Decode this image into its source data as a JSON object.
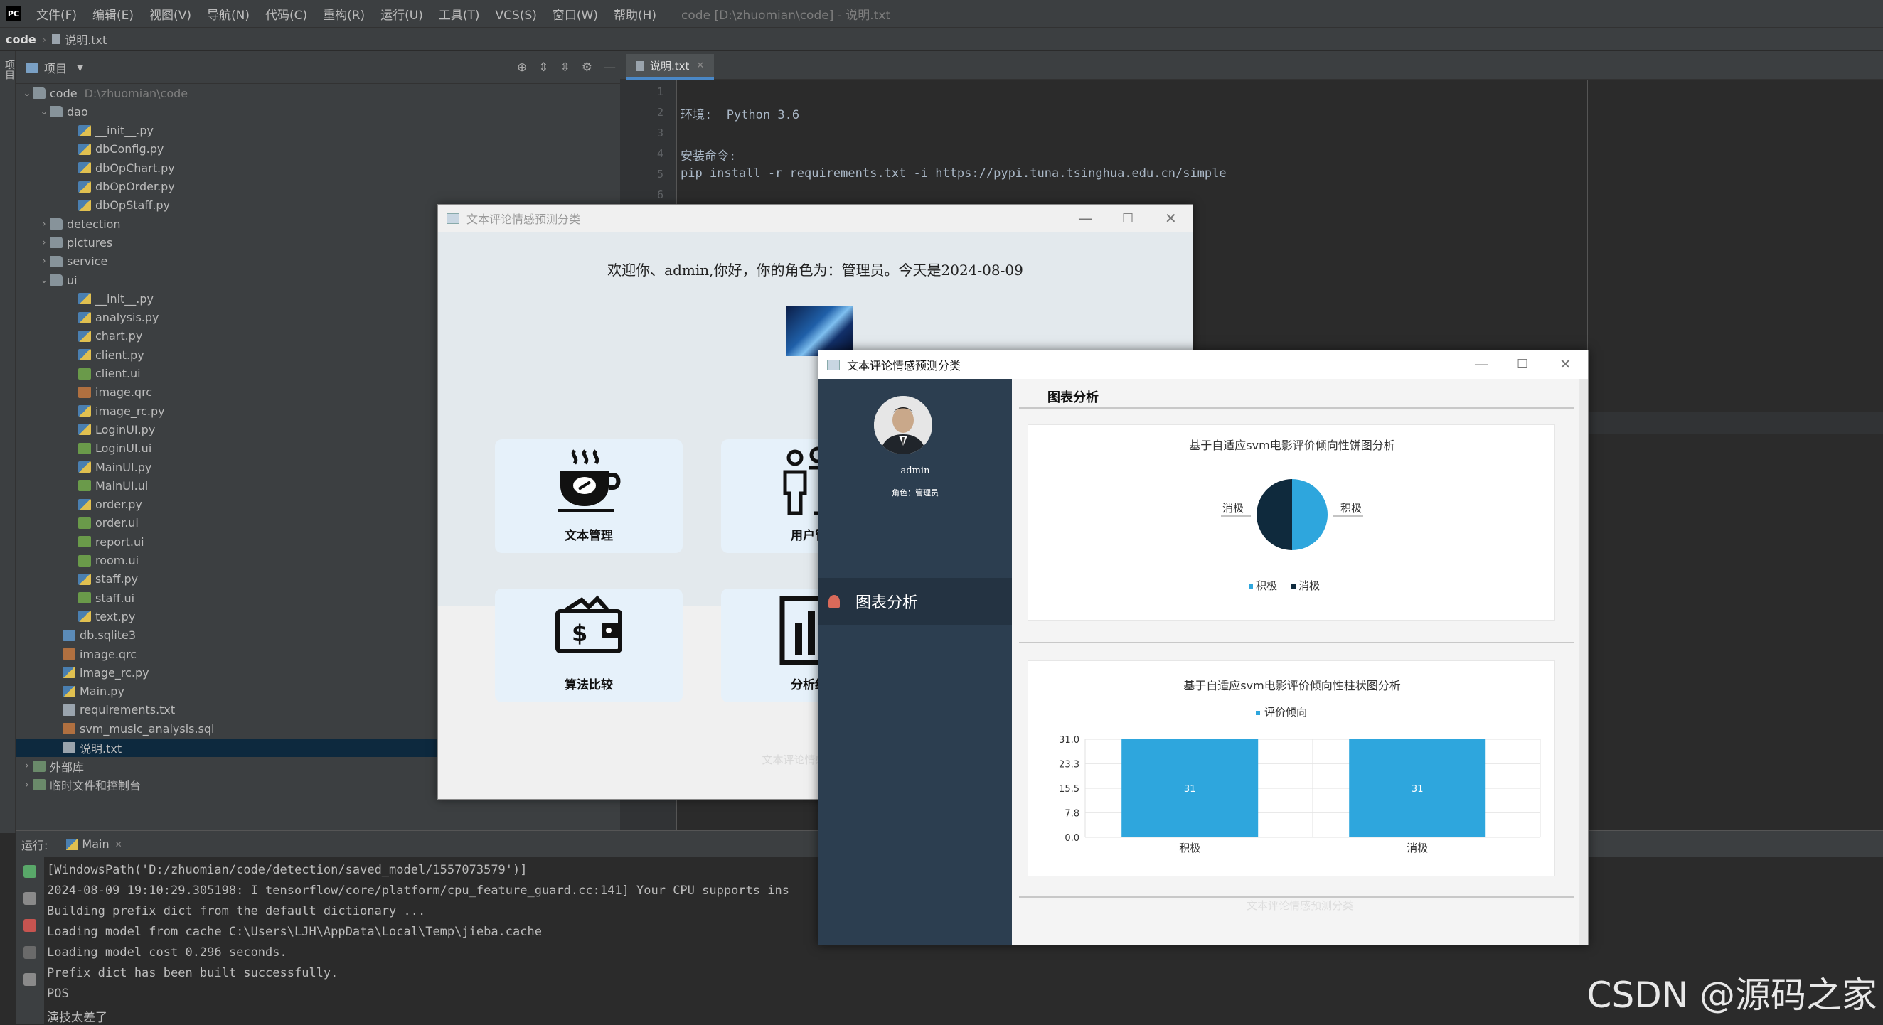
{
  "ide": {
    "menus": [
      "文件(F)",
      "编辑(E)",
      "视图(V)",
      "导航(N)",
      "代码(C)",
      "重构(R)",
      "运行(U)",
      "工具(T)",
      "VCS(S)",
      "窗口(W)",
      "帮助(H)"
    ],
    "window_title": "code [D:\\zhuomian\\code] - 说明.txt",
    "breadcrumb_root": "code",
    "breadcrumb_file": "说明.txt",
    "left_strip_label": "项目",
    "project_label": "项目",
    "tree": {
      "root": {
        "name": "code",
        "path": "D:\\zhuomian\\code"
      },
      "dao": "dao",
      "dao_files": [
        "__init__.py",
        "dbConfig.py",
        "dbOpChart.py",
        "dbOpOrder.py",
        "dbOpStaff.py"
      ],
      "folders": [
        "detection",
        "pictures",
        "service"
      ],
      "ui": "ui",
      "ui_files": [
        "__init__.py",
        "analysis.py",
        "chart.py",
        "client.py",
        "client.ui",
        "image.qrc",
        "image_rc.py",
        "LoginUI.py",
        "LoginUI.ui",
        "MainUI.py",
        "MainUI.ui",
        "order.py",
        "order.ui",
        "report.ui",
        "room.ui",
        "staff.py",
        "staff.ui",
        "text.py"
      ],
      "root_files": [
        "db.sqlite3",
        "image.qrc",
        "image_rc.py",
        "Main.py",
        "requirements.txt",
        "svm_music_analysis.sql",
        "说明.txt"
      ],
      "external_libs": "外部库",
      "scratches": "临时文件和控制台"
    },
    "editor": {
      "tab": "说明.txt",
      "line_numbers": [
        "1",
        "2",
        "3",
        "4",
        "5",
        "6"
      ],
      "lines": [
        "",
        "环境:  Python 3.6",
        "",
        "安装命令:",
        "pip install -r requirements.txt -i https://pypi.tuna.tsinghua.edu.cn/simple",
        ""
      ]
    },
    "run": {
      "label": "运行:",
      "tab": "Main",
      "console": [
        "[WindowsPath('D:/zhuomian/code/detection/saved_model/1557073579')]",
        "2024-08-09 19:10:29.305198: I tensorflow/core/platform/cpu_feature_guard.cc:141] Your CPU supports ins",
        "Building prefix dict from the default dictionary ...",
        "Loading model from cache C:\\Users\\LJH\\AppData\\Local\\Temp\\jieba.cache",
        "Loading model cost 0.296 seconds.",
        "Prefix dict has been built successfully.",
        "POS",
        "演技太差了"
      ]
    }
  },
  "window1": {
    "title": "文本评论情感预测分类",
    "welcome": "欢迎你、admin,你好，你的角色为：管理员。今天是2024-08-09",
    "cards": [
      "文本管理",
      "用户管",
      "算法比较",
      "分析结"
    ],
    "footer": "文本评论情感预测分类"
  },
  "window2": {
    "title": "文本评论情感预测分类",
    "username": "admin",
    "role": "角色：管理员",
    "nav_item": "图表分析",
    "page_title": "图表分析",
    "footer": "文本评论情感预测分类"
  },
  "chart_data": [
    {
      "type": "pie",
      "title": "基于自适应svm电影评价倾向性饼图分析",
      "labels": [
        "积极",
        "消极"
      ],
      "values": [
        31,
        31
      ],
      "colors": [
        "#2ea6dd",
        "#0f2a3d"
      ],
      "legend": "bottom"
    },
    {
      "type": "bar",
      "title": "基于自适应svm电影评价倾向性柱状图分析",
      "categories": [
        "积极",
        "消极"
      ],
      "series": [
        {
          "name": "评价倾向",
          "values": [
            31,
            31
          ]
        }
      ],
      "data_labels": [
        "31",
        "31"
      ],
      "yticks": [
        "31.0",
        "23.3",
        "15.5",
        "7.8",
        "0.0"
      ],
      "ylim": [
        0,
        31
      ],
      "legend": "top",
      "grid": true,
      "color": "#2ea6dd"
    }
  ],
  "watermark": "CSDN @源码之家"
}
